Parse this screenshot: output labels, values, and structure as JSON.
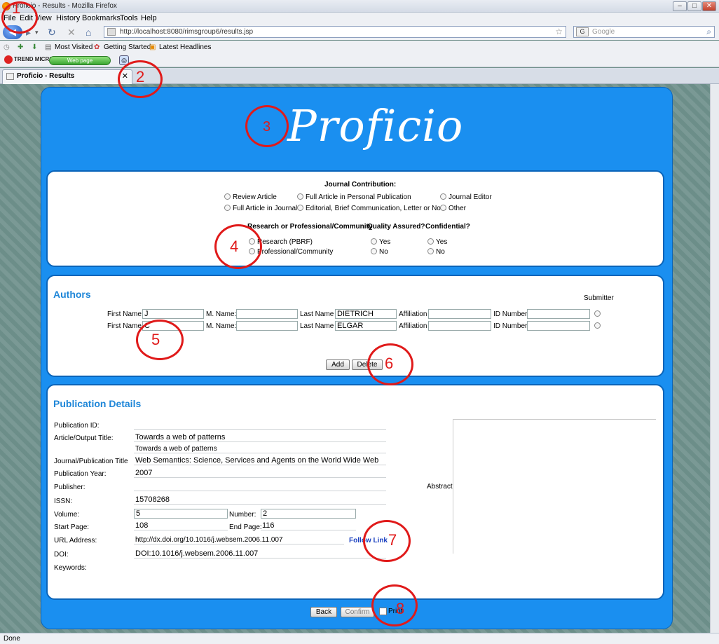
{
  "browser": {
    "window_title": "Proficio - Results - Mozilla Firefox",
    "menu": [
      "File",
      "Edit",
      "View",
      "History",
      "Bookmarks",
      "Tools",
      "Help"
    ],
    "url": "http://localhost:8080/rimsgroup6/results.jsp",
    "search_placeholder": "Google",
    "bookmarks": [
      "Most Visited",
      "Getting Started",
      "Latest Headlines"
    ],
    "trend_logo": "TREND MICRO",
    "trend_pill": "Web page",
    "tab_title": "Proficio - Results",
    "status": "Done"
  },
  "page": {
    "logo": "Proficio",
    "journal": {
      "heading": "Journal Contribution:",
      "options_row1": [
        "Review Article",
        "Full Article in Personal Publication",
        "Journal Editor"
      ],
      "options_row2": [
        "Full Article in Journal",
        "Editorial, Brief Communication, Letter or Note",
        "Other"
      ],
      "research_heading": "Research or Professional/Community",
      "research_options": [
        "Research (PBRF)",
        "Professional/Community"
      ],
      "quality_heading": "Quality Assured?",
      "quality_options": [
        "Yes",
        "No"
      ],
      "confidential_heading": "Confidential?",
      "confidential_options": [
        "Yes",
        "No"
      ]
    },
    "authors": {
      "heading": "Authors",
      "submitter_label": "Submitter",
      "labels": {
        "first": "First Name:",
        "middle": "M. Name:",
        "last": "Last Name",
        "affiliation": "Affiliation",
        "id": "ID Number"
      },
      "rows": [
        {
          "first": "J",
          "middle": "",
          "last": "DIETRICH",
          "affiliation": "",
          "id": ""
        },
        {
          "first": "C",
          "middle": "",
          "last": "ELGAR",
          "affiliation": "",
          "id": ""
        }
      ],
      "add_label": "Add",
      "delete_label": "Delete"
    },
    "publication": {
      "heading": "Publication Details",
      "labels": {
        "pub_id": "Publication ID:",
        "article_title": "Article/Output Title:",
        "journal_title": "Journal/Publication Title",
        "year": "Publication Year:",
        "publisher": "Publisher:",
        "issn": "ISSN:",
        "volume": "Volume:",
        "number": "Number:",
        "start_page": "Start Page:",
        "end_page": "End Page:",
        "url": "URL Address:",
        "doi": "DOI:",
        "keywords": "Keywords:",
        "abstract": "Abstract:"
      },
      "values": {
        "pub_id": "",
        "article_title": "Towards a web of patterns",
        "article_title2": "Towards a web of patterns",
        "journal_title": "Web Semantics: Science, Services and Agents on the World Wide Web",
        "year": "2007",
        "publisher": "",
        "issn": "15708268",
        "volume": "5",
        "number": "2",
        "start_page": "108",
        "end_page": "116",
        "url": "http://dx.doi.org/10.1016/j.websem.2006.11.007",
        "doi": "DOI:10.1016/j.websem.2006.11.007",
        "keywords": ""
      },
      "follow_link": "Follow Link"
    },
    "bottom": {
      "back_label": "Back",
      "confirm_label": "Confirm",
      "print_label": "Print"
    }
  },
  "annotations": [
    "1",
    "2",
    "3",
    "4",
    "5",
    "6",
    "7",
    "8"
  ],
  "colors": {
    "page_blue": "#1a8ff0",
    "heading_blue": "#1e86d8",
    "annotation_red": "#e01a1a"
  }
}
